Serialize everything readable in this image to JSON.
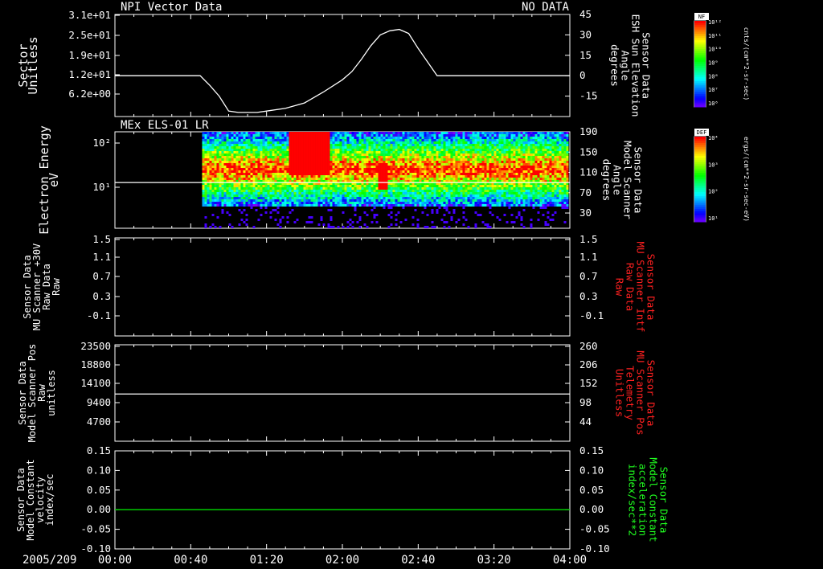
{
  "header": {
    "panel1_title": "NPI Vector Data",
    "panel1_status": "NO DATA",
    "panel2_title": "MEx ELS-01 LR"
  },
  "time_axis": {
    "date_label": "2005/209",
    "ticks": [
      "00:00",
      "00:40",
      "01:20",
      "02:00",
      "02:40",
      "03:20",
      "04:00"
    ]
  },
  "colorbars": [
    {
      "badge": "NF",
      "unit": "cnts/(cm**2-sr-sec)",
      "ticks": [
        "10¹²",
        "10¹¹",
        "10¹⁰",
        "10⁹",
        "10⁸",
        "10⁷",
        "10⁶"
      ]
    },
    {
      "badge": "DEF",
      "unit": "ergs/(cm**2-sr-sec-eV)",
      "ticks": [
        "10⁴",
        "10³",
        "10²",
        "10¹"
      ]
    }
  ],
  "colors": {
    "background": "#000000",
    "line_white": "#ffffff",
    "line_green": "#00dd00",
    "label_red": "#ff2020",
    "label_green": "#20ff20"
  },
  "chart_data": [
    {
      "type": "line",
      "title": "NPI Vector Data",
      "ylabel": [
        "Sector",
        "Unitless"
      ],
      "ylabel_right": [
        "Sensor Data",
        "ESH Sun Elevation",
        "Angle",
        "degrees"
      ],
      "ylabel_right_color": "white",
      "yticks_left": [
        "3.1e+01",
        "2.5e+01",
        "1.9e+01",
        "1.2e+01",
        "6.2e+00"
      ],
      "yticks_right": [
        "45",
        "30",
        "15",
        "0",
        "-15"
      ],
      "ylim_right": [
        -30,
        45
      ],
      "x_minutes": [
        0,
        30,
        40,
        45,
        50,
        55,
        60,
        65,
        70,
        75,
        80,
        90,
        100,
        110,
        120,
        125,
        130,
        135,
        140,
        145,
        150,
        155,
        160,
        170,
        180,
        200,
        220,
        240
      ],
      "y_degrees": [
        0,
        0,
        0,
        0,
        -7,
        -15,
        -26,
        -27,
        -27,
        -27,
        -26,
        -24,
        -20,
        -12,
        -3,
        3,
        12,
        22,
        30,
        33,
        34,
        31,
        20,
        0,
        0,
        0,
        0,
        0
      ]
    },
    {
      "type": "heatmap",
      "title": "MEx ELS-01 LR",
      "ylabel": [
        "Electron Energy",
        "eV"
      ],
      "ylabel_right": [
        "Sensor Data",
        "Model Scanner",
        "Angle",
        "degrees"
      ],
      "ylabel_right_color": "white",
      "yticks_left": [
        "10²",
        "10¹"
      ],
      "yticks_right": [
        "190",
        "150",
        "110",
        "70",
        "30"
      ],
      "ylim_right": [
        0,
        190
      ],
      "data_start_minutes": 46,
      "white_line_degrees": [
        [
          0,
          90
        ],
        [
          240,
          90
        ]
      ],
      "note_no_values": true
    },
    {
      "type": "line",
      "ylabel": [
        "Sensor Data",
        "MU Scanner +30V",
        "Raw Data",
        "Raw"
      ],
      "ylabel_right": [
        "Sensor Data",
        "MU Scanner Intf",
        "Raw Data",
        "Raw"
      ],
      "ylabel_right_color": "red",
      "yticks_left": [
        "1.5",
        "1.1",
        "0.7",
        "0.3",
        "-0.1"
      ],
      "yticks_right": [
        "1.5",
        "1.1",
        "0.7",
        "0.3",
        "-0.1"
      ],
      "ylim": [
        -0.5,
        1.5
      ]
    },
    {
      "type": "line",
      "ylabel": [
        "Sensor Data",
        "Model Scanner Pos",
        "Raw",
        "unitless"
      ],
      "ylabel_right": [
        "Sensor Data",
        "MU Scanner Pos",
        "Telemetry",
        "Unitless"
      ],
      "ylabel_right_color": "red",
      "yticks_left": [
        "23500",
        "18800",
        "14100",
        "9400",
        "4700"
      ],
      "yticks_right": [
        "260",
        "206",
        "152",
        "98",
        "44"
      ],
      "ylim": [
        0,
        23500
      ],
      "series": [
        {
          "x_minutes": [
            0,
            240
          ],
          "values": [
            11500,
            11500
          ]
        }
      ]
    },
    {
      "type": "line",
      "ylabel": [
        "Sensor Data",
        "Model Constant",
        "velocity",
        "index/sec"
      ],
      "ylabel_right": [
        "Sensor Data",
        "Model Constant",
        "acceleration",
        "index/sec**2"
      ],
      "ylabel_right_color": "green",
      "yticks_left": [
        "0.15",
        "0.10",
        "0.05",
        "0.00",
        "-0.05",
        "-0.10"
      ],
      "yticks_right": [
        "0.15",
        "0.10",
        "0.05",
        "0.00",
        "-0.05",
        "-0.10"
      ],
      "ylim": [
        -0.1,
        0.15
      ],
      "series": [
        {
          "x_minutes": [
            0,
            240
          ],
          "values": [
            0.0,
            0.0
          ]
        }
      ]
    }
  ]
}
